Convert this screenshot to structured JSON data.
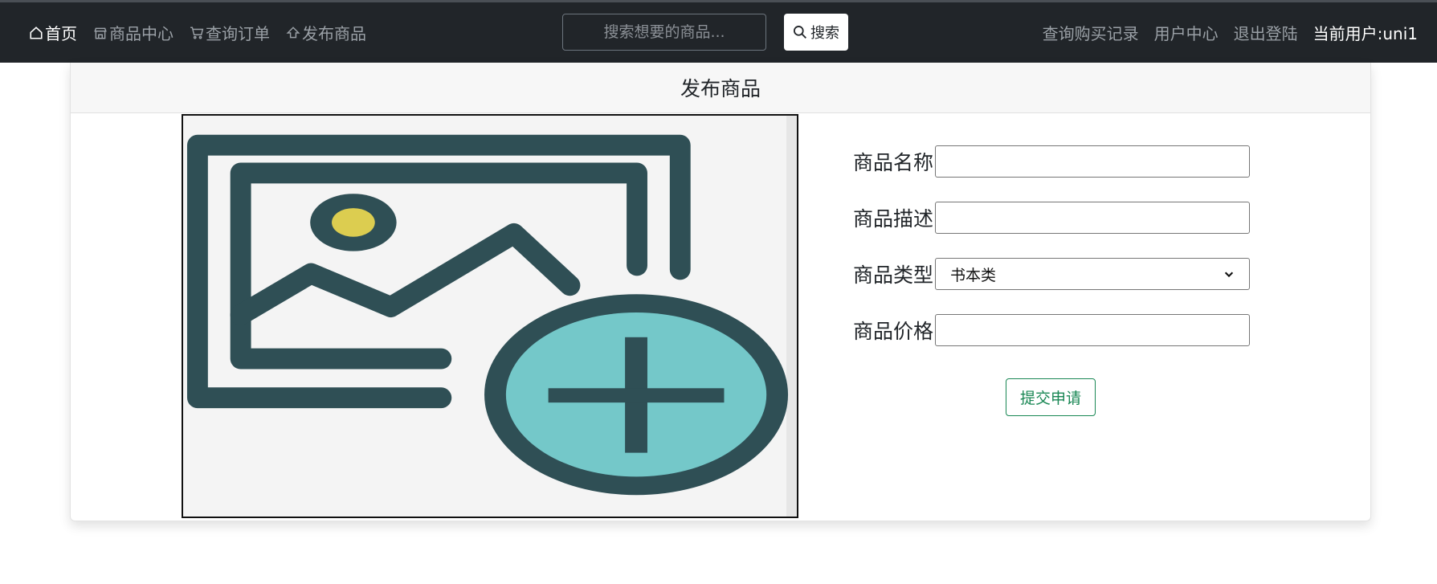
{
  "navbar": {
    "left_items": [
      {
        "label": "首页",
        "icon": "home-icon",
        "active": true
      },
      {
        "label": "商品中心",
        "icon": "shop-icon",
        "active": false
      },
      {
        "label": "查询订单",
        "icon": "cart-icon",
        "active": false
      },
      {
        "label": "发布商品",
        "icon": "upload-icon",
        "active": false
      }
    ],
    "search": {
      "placeholder": "搜索想要的商品...",
      "value": "",
      "button_label": "搜索",
      "button_icon": "search-icon"
    },
    "right_items": [
      {
        "label": "查询购买记录"
      },
      {
        "label": "用户中心"
      },
      {
        "label": "退出登陆"
      }
    ],
    "current_user": "当前用户:uni1"
  },
  "card": {
    "title": "发布商品",
    "upload_image": {
      "icon": "add-image-icon"
    },
    "form": {
      "name": {
        "label": "商品名称",
        "value": ""
      },
      "description": {
        "label": "商品描述",
        "value": ""
      },
      "type": {
        "label": "商品类型",
        "selected": "书本类"
      },
      "price": {
        "label": "商品价格",
        "value": ""
      },
      "submit_label": "提交申请"
    }
  },
  "colors": {
    "navbar_bg": "#212529",
    "accent_green": "#198754",
    "icon_dark": "#2f4f55",
    "icon_teal": "#74c8c9",
    "icon_yellow": "#dccd50"
  }
}
